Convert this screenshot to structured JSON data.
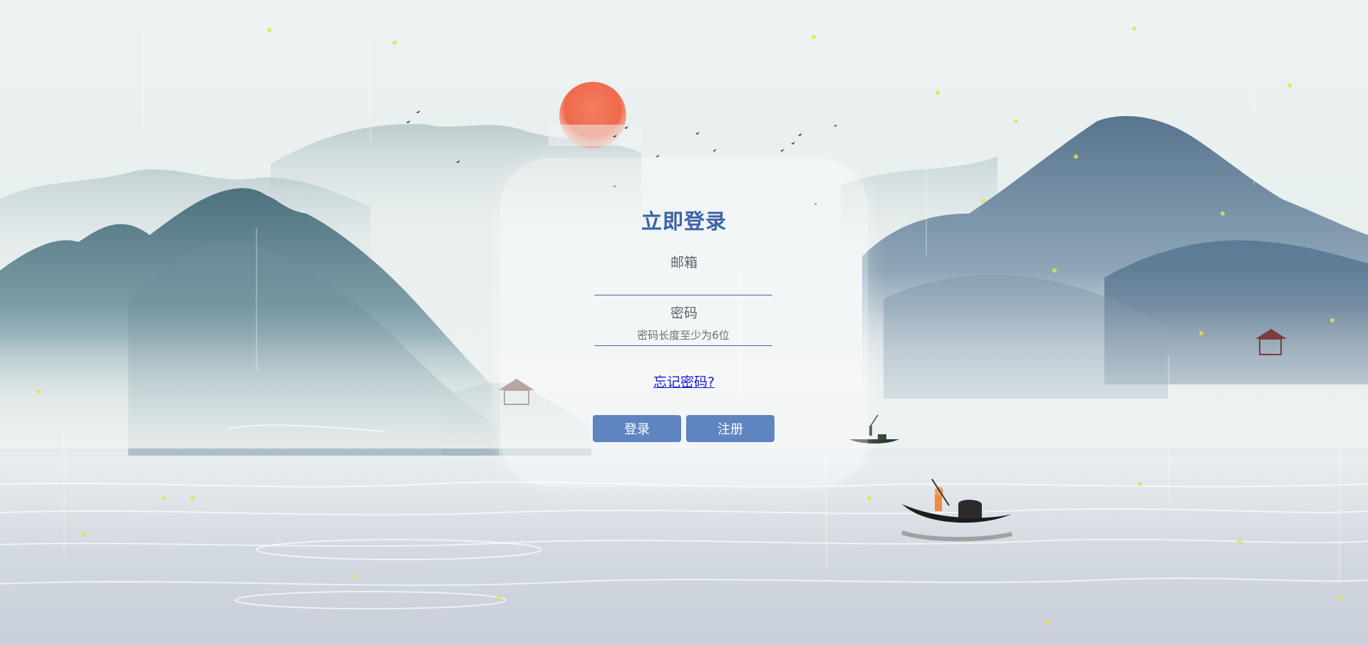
{
  "login_form": {
    "title": "立即登录",
    "email_label": "邮箱",
    "email_value": "",
    "email_placeholder": "",
    "password_label": "密码",
    "password_value": "",
    "password_placeholder": "密码长度至少为6位",
    "forgot_link": "忘记密码?",
    "login_button": "登录",
    "register_button": "注册"
  },
  "colors": {
    "title": "#3c63a7",
    "button": "#5e85c0",
    "link": "#1a1ad9",
    "input_underline": "#4767a6",
    "sun": "#f26b4e"
  }
}
